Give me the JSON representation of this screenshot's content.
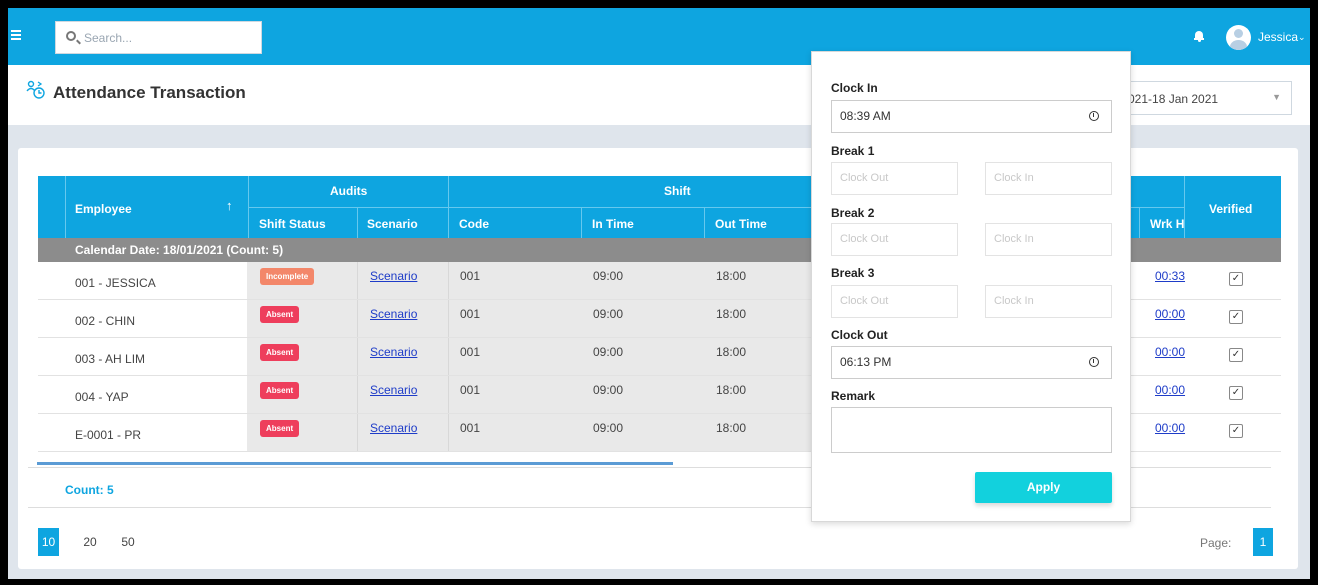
{
  "topbar": {
    "search_placeholder": "Search...",
    "username": "Jessica",
    "caret": "⌄"
  },
  "page": {
    "title": "Attendance Transaction",
    "date_range": "021-18 Jan 2021"
  },
  "table": {
    "headers": {
      "employee": "Employee",
      "sort_arrow": "↑",
      "audits": "Audits",
      "shift": "Shift",
      "shift_status": "Shift Status",
      "scenario": "Scenario",
      "code": "Code",
      "in_time": "In Time",
      "out_time": "Out Time",
      "wrk_h": "Wrk H",
      "verified": "Verified"
    },
    "group_label": "Calendar Date: 18/01/2021 (Count: 5)",
    "rows": [
      {
        "employee": "001 - JESSICA",
        "status": "Incomplete",
        "scenario": "Scenario",
        "code": "001",
        "in": "09:00",
        "out": "18:00",
        "wrk": "00:33",
        "verified": "✓"
      },
      {
        "employee": "002 - CHIN",
        "status": "Absent",
        "scenario": "Scenario",
        "code": "001",
        "in": "09:00",
        "out": "18:00",
        "wrk": "00:00",
        "verified": "✓"
      },
      {
        "employee": "003 - AH LIM",
        "status": "Absent",
        "scenario": "Scenario",
        "code": "001",
        "in": "09:00",
        "out": "18:00",
        "wrk": "00:00",
        "verified": "✓"
      },
      {
        "employee": "004 - YAP",
        "status": "Absent",
        "scenario": "Scenario",
        "code": "001",
        "in": "09:00",
        "out": "18:00",
        "wrk": "00:00",
        "verified": "✓"
      },
      {
        "employee": "E-0001 - PR",
        "status": "Absent",
        "scenario": "Scenario",
        "code": "001",
        "in": "09:00",
        "out": "18:00",
        "wrk": "00:00",
        "verified": "✓"
      }
    ],
    "count_label": "Count: 5"
  },
  "pagination": {
    "page_sizes": [
      "10",
      "20",
      "50"
    ],
    "page_label": "Page:",
    "current_page": "1"
  },
  "popup": {
    "clock_in_label": "Clock In",
    "clock_in_value": "08:39 AM",
    "break1_label": "Break 1",
    "break2_label": "Break 2",
    "break3_label": "Break 3",
    "break_out_placeholder": "Clock Out",
    "break_in_placeholder": "Clock In",
    "clock_out_label": "Clock Out",
    "clock_out_value": "06:13 PM",
    "remark_label": "Remark",
    "apply_label": "Apply"
  },
  "colors": {
    "brand": "#0ea5e0",
    "incomplete": "#f3876a",
    "absent": "#ee3e5c",
    "apply": "#12d1dd"
  }
}
